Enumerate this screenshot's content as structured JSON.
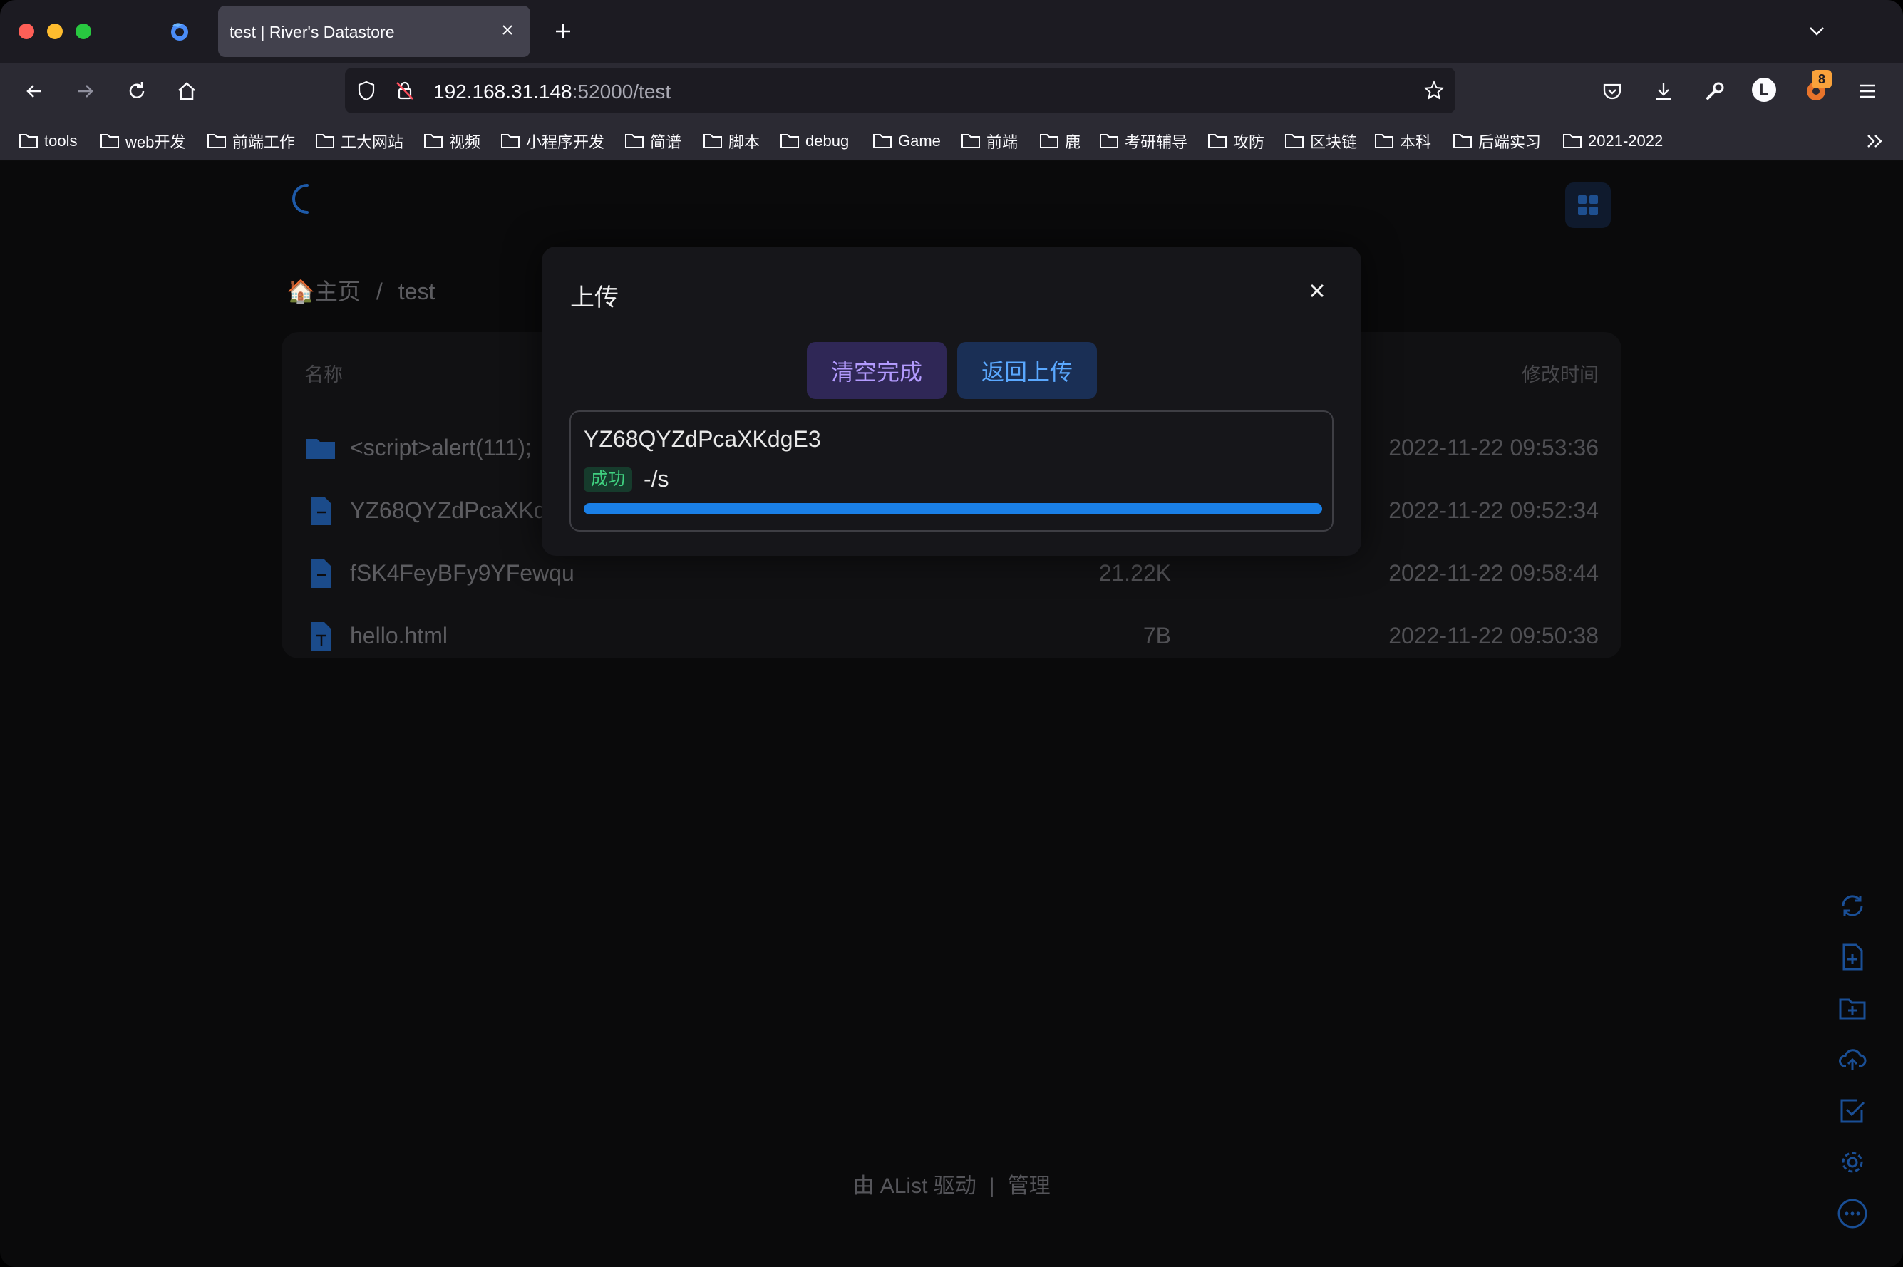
{
  "browser": {
    "tab_title": "test | River's Datastore",
    "url_host": "192.168.31.148",
    "url_rest": ":52000/test",
    "extension_badge": "8",
    "account_initial": "L"
  },
  "bookmarks": [
    "tools",
    "web开发",
    "前端工作",
    "工大网站",
    "视频",
    "小程序开发",
    "简谱",
    "脚本",
    "debug",
    "Game",
    "前端",
    "鹿",
    "考研辅导",
    "攻防",
    "区块链",
    "本科",
    "后端实习",
    "2021-2022"
  ],
  "page": {
    "breadcrumb_home": "🏠主页",
    "breadcrumb_sep": "/",
    "breadcrumb_current": "test",
    "columns": {
      "name": "名称",
      "modified": "修改时间"
    },
    "files": [
      {
        "name": "<script>alert(111);",
        "size": "",
        "modified": "2022-11-22 09:53:36",
        "type": "folder"
      },
      {
        "name": "YZ68QYZdPcaXKdgE3",
        "size": "",
        "modified": "2022-11-22 09:52:34",
        "type": "file"
      },
      {
        "name": "fSK4FeyBFy9YFewqu",
        "size": "21.22K",
        "modified": "2022-11-22 09:58:44",
        "type": "file"
      },
      {
        "name": "hello.html",
        "size": "7B",
        "modified": "2022-11-22 09:50:38",
        "type": "text"
      }
    ],
    "footer_powered": "由 AList 驱动",
    "footer_sep": "|",
    "footer_manage": "管理"
  },
  "modal": {
    "title": "上传",
    "clear_button": "清空完成",
    "back_button": "返回上传",
    "item_name": "YZ68QYZdPcaXKdgE3",
    "item_status": "成功",
    "item_speed": "-/s",
    "progress_percent": 100
  },
  "colors": {
    "accent": "#1a7fe6",
    "success": "#3fd07f",
    "purple": "#b39bff"
  }
}
